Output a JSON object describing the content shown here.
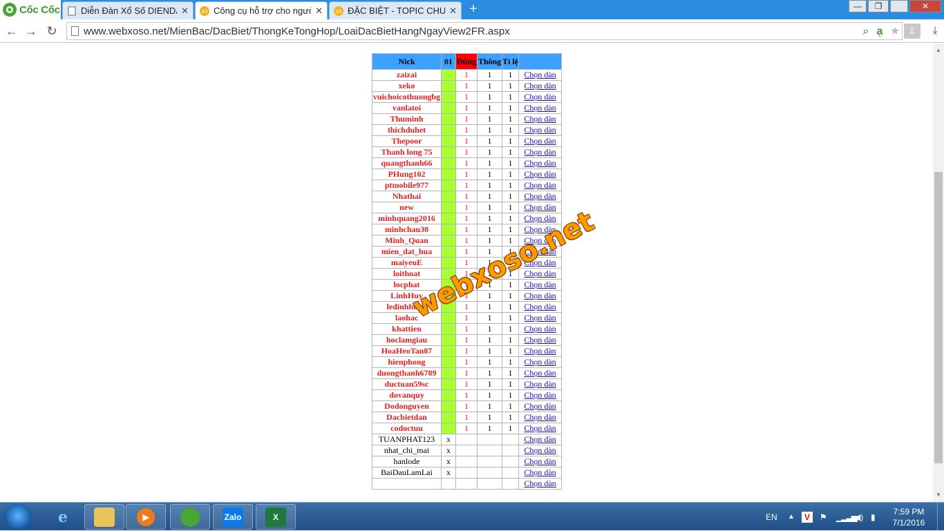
{
  "browser": {
    "logo_text": "Cốc Cốc",
    "tabs": [
      {
        "title": "Diễn Đàn Xổ Số DIENDAN.",
        "icon": "page-icon",
        "active": false
      },
      {
        "title": "Công cụ hỗ trợ cho người",
        "icon": "xs-favicon",
        "active": true
      },
      {
        "title": "ĐẶC BIỆT - TOPIC CHUYÊN",
        "icon": "xs-favicon",
        "active": false
      }
    ],
    "new_tab_label": "+",
    "url": "www.webxoso.net/MienBac/DacBiet/ThongKeTongHop/LoaiDacBietHangNgayView2FR.aspx",
    "win_min": "—",
    "win_max": "❐",
    "win_close": "✕"
  },
  "table": {
    "headers": {
      "nick": "Nick",
      "c01": "01",
      "dung": "Đúng",
      "thong": "Thông",
      "tile": "Tỉ lệ",
      "action": ""
    },
    "action_label": "Chọn dàn",
    "winners": [
      "zaizai",
      "xeko",
      "vuichoicothuongbg",
      "vanlatoi",
      "Thuminh",
      "thichduhet",
      "Thepoor",
      "Thanh long 75",
      "quangthanh66",
      "PHung102",
      "ptmobile977",
      "Nhathai",
      "new",
      "minhquang2016",
      "minhchau38",
      "Minh_Quan",
      "mien_dat_hua",
      "maiyeuE",
      "loithoat",
      "locphat",
      "LinhHuy",
      "ledinhhung",
      "laohac",
      "khattien",
      "hoclamgiau",
      "HoaHeoTan87",
      "hienphong",
      "duongthanh6789",
      "ductuan59sc",
      "dovanquy",
      "Dodonguyen",
      "Dacbietdan",
      "codoctuu"
    ],
    "winner_values": {
      "dung": "1",
      "thong": "1",
      "tile": "1"
    },
    "others": [
      "TUANPHAT123",
      "nhat_chi_mai",
      "hanlode",
      "BaiDauLamLai"
    ],
    "other_mark": "x"
  },
  "watermark": "webxoso.net",
  "taskbar": {
    "apps": [
      "ie-icon",
      "explorer-icon",
      "media-player-icon",
      "coccoc-icon",
      "zalo-icon",
      "excel-icon"
    ],
    "zalo_label": "Zalo",
    "excel_label": "X",
    "lang": "EN",
    "time": "7:59 PM",
    "date": "7/1/2016"
  }
}
